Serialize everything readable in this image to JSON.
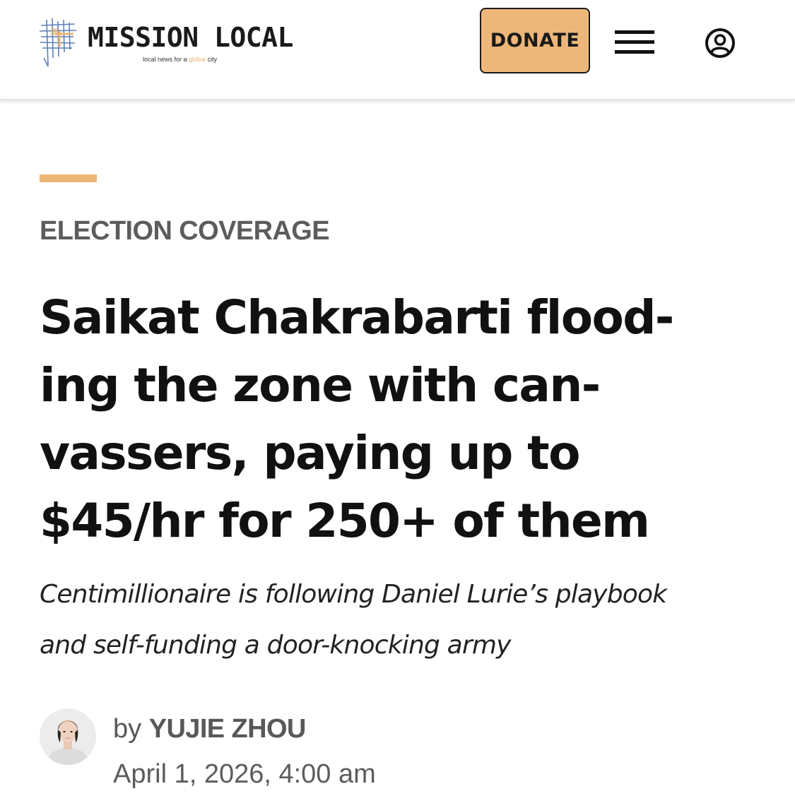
{
  "header": {
    "logo_name": "MISSION LOCAL",
    "logo_tagline_prefix": "local news for a",
    "logo_tagline_accent": "global",
    "logo_tagline_suffix": "city",
    "donate_label": "DONATE",
    "menu_icon": "hamburger-menu-icon",
    "account_icon": "user-account-icon"
  },
  "article": {
    "category": "ELECTION COVERAGE",
    "headline_lines": [
      "Saikat Chakrabarti flood-",
      "ing the zone with can-",
      "vassers, paying up to",
      "$45/hr for 250+ of them"
    ],
    "dek_lines": [
      "Centimillionaire is following Daniel Lurie’s playbook",
      "and self-funding a door-knocking army"
    ],
    "byline_prefix": "by",
    "author": "YUJIE ZHOU",
    "date": "April 1, 2026, 4:00 am"
  },
  "colors": {
    "accent": "#ecb677",
    "donate_bg": "#eeb77a",
    "text": "#111111",
    "muted": "#5c5c5c",
    "logo_blue": "#5d7fb8",
    "logo_orange": "#e9b46f"
  }
}
